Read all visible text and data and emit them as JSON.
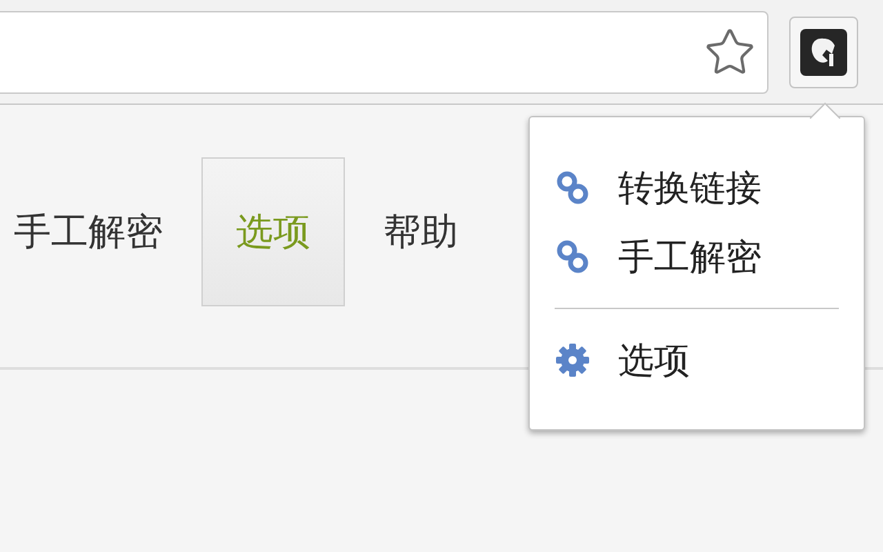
{
  "nav_tabs": [
    {
      "label": "手工解密",
      "selected": false
    },
    {
      "label": "选项",
      "selected": true
    },
    {
      "label": "帮助",
      "selected": false
    }
  ],
  "popup_menu": {
    "items": [
      {
        "label": "转换链接",
        "kind": "link"
      },
      {
        "label": "手工解密",
        "kind": "link"
      },
      {
        "kind": "divider"
      },
      {
        "label": "选项",
        "kind": "settings"
      }
    ]
  }
}
